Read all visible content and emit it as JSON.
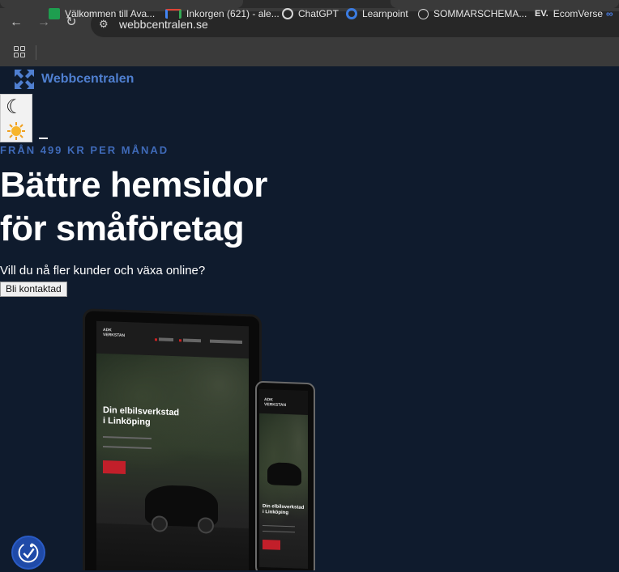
{
  "browser": {
    "url": "webbcentralen.se",
    "nav_icons": [
      "back-arrow-icon",
      "forward-arrow-icon",
      "reload-icon"
    ],
    "bookmarks": [
      {
        "label": "Välkommen till Ava...",
        "icon": "sheets-icon",
        "color": "#1e9e4f"
      },
      {
        "label": "Inkorgen (621) - ale...",
        "icon": "gmail-icon",
        "color": "#e04335"
      },
      {
        "label": "ChatGPT",
        "icon": "chatgpt-icon",
        "color": "#d8d8d8"
      },
      {
        "label": "Learnpoint",
        "icon": "learnpoint-icon",
        "color": "#3b7be0"
      },
      {
        "label": "SOMMARSCHEMA...",
        "icon": "check-circle-icon",
        "color": "#d8d8d8"
      },
      {
        "label": "EcomVerse",
        "icon": "ev-icon",
        "color": "#ffffff"
      }
    ],
    "ev_logo": "EV."
  },
  "site": {
    "brand": "Webbcentralen",
    "brand_color": "#4f7fd0",
    "eyebrow": "FRÅN 499 KR PER MÅNAD",
    "headline_line1": "Bättre hemsidor",
    "headline_line2": "för småföretag",
    "subheading": "Vill du nå fler kunder och växa online?",
    "cta_label": "Bli kontaktad",
    "background": "#0f1b2d"
  },
  "mockup": {
    "logo_line1": "ADK",
    "logo_line2": "VERKSTAN",
    "title_line1": "Din elbilsverkstad",
    "title_line2": "i Linköping"
  }
}
